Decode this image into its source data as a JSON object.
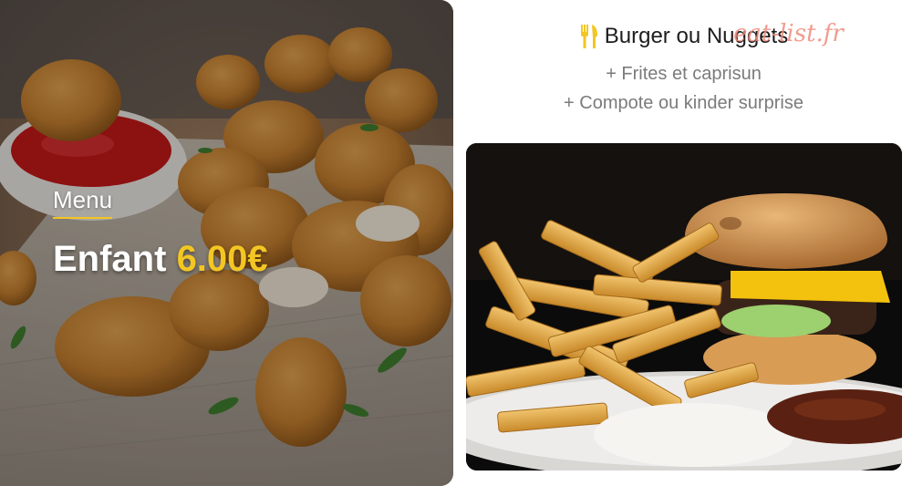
{
  "hero": {
    "label": "Menu",
    "title_text": "Enfant",
    "price": "6.00€",
    "image_subject": "chicken-nuggets-with-ketchup"
  },
  "menu": {
    "title": "Burger ou Nuggets",
    "lines": [
      "+ Frites et caprisun",
      "+ Compote ou kinder surprise"
    ],
    "icon": "fork-knife-icon"
  },
  "watermark": {
    "text": "eat-list.fr"
  },
  "photo": {
    "image_subject": "burger-and-fries"
  },
  "colors": {
    "accent": "#f3c623",
    "text_dark": "#1d1d1d",
    "text_muted": "#7b7b7b",
    "watermark": "#f08a7c"
  }
}
